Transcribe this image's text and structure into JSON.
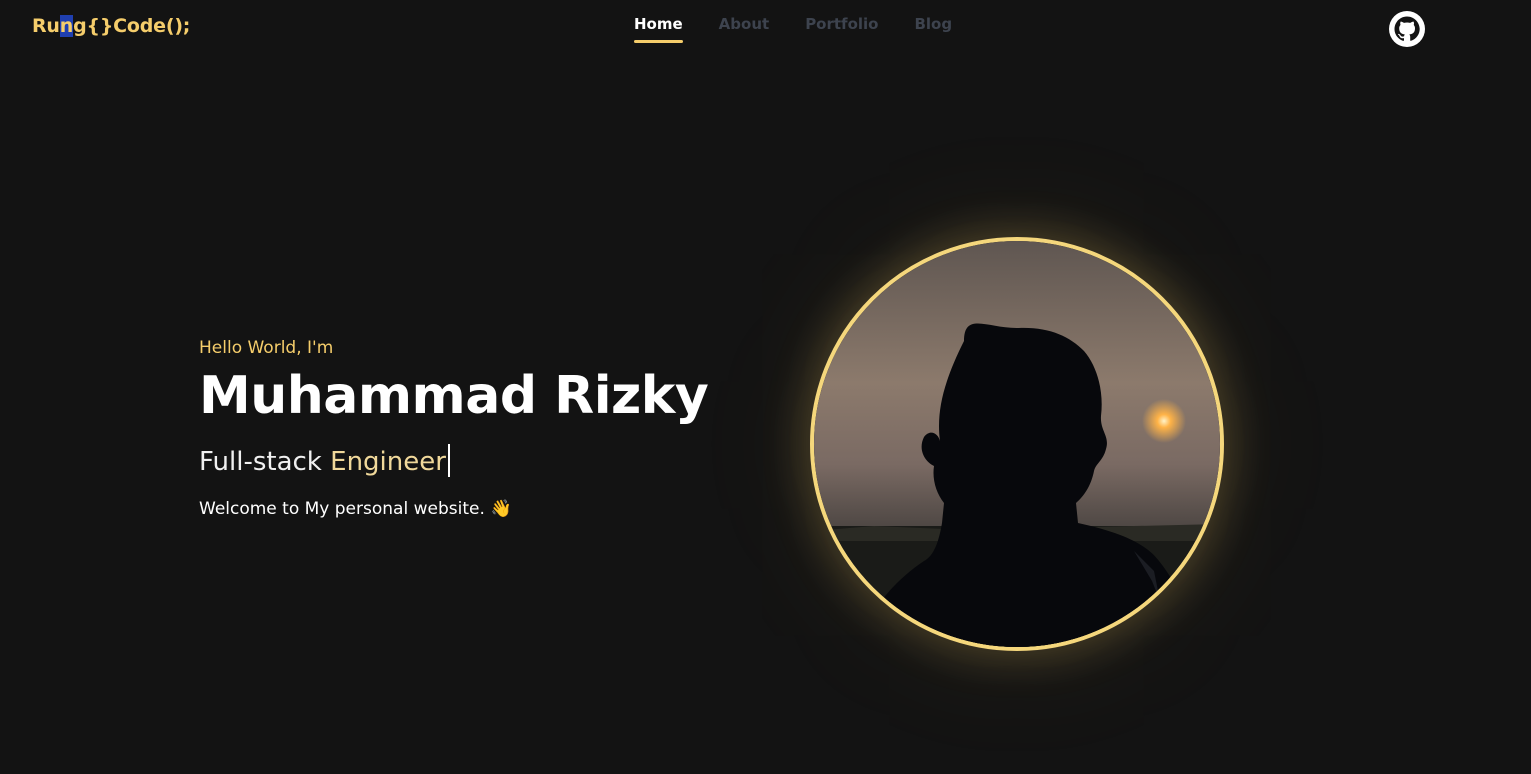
{
  "header": {
    "logo_before": "Ru",
    "logo_selected": "n",
    "logo_after": "g{}Code();",
    "nav": [
      {
        "label": "Home",
        "active": true
      },
      {
        "label": "About",
        "active": false
      },
      {
        "label": "Portfolio",
        "active": false
      },
      {
        "label": "Blog",
        "active": false
      }
    ],
    "github_icon": "github-icon"
  },
  "hero": {
    "greeting": "Hello World, I'm",
    "name": "Muhammad Rizky",
    "role_prefix": "Full-stack ",
    "role_highlight": "Engineer",
    "welcome": "Welcome to My personal website.",
    "wave_icon": "👋"
  },
  "portrait": {
    "subject": "silhouette-at-sunset-photo"
  },
  "colors": {
    "background": "#131313",
    "accent": "#f5cd6b",
    "nav_inactive": "#3d434e",
    "text": "#ffffff"
  }
}
